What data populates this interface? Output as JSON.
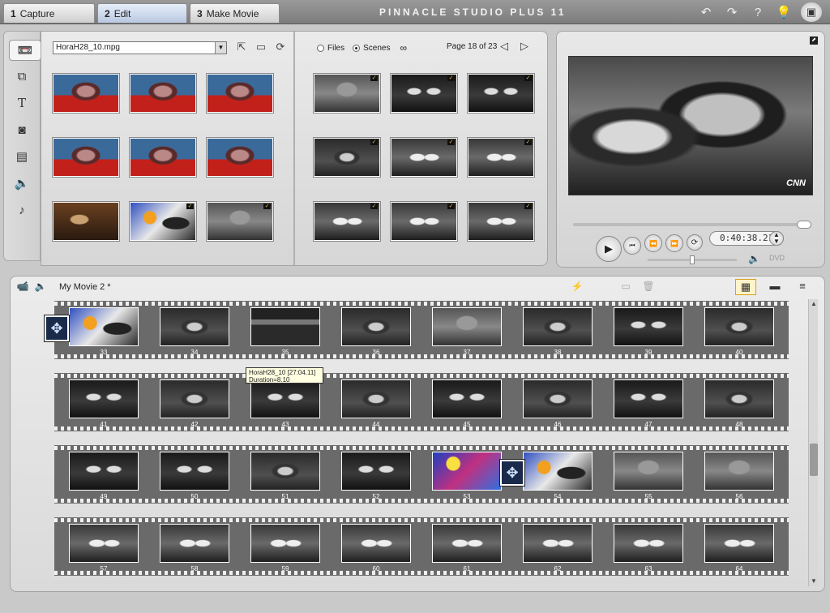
{
  "tabs": [
    {
      "num": "1",
      "label": "Capture"
    },
    {
      "num": "2",
      "label": "Edit"
    },
    {
      "num": "3",
      "label": "Make Movie"
    }
  ],
  "app_title": "PINNACLE STUDIO PLUS 11",
  "top_icons": {
    "undo": "↶",
    "redo": "↷",
    "help": "?",
    "hint": "💡",
    "box": "▣"
  },
  "album": {
    "file_name": "HoraH28_10.mpg",
    "radio_files": "Files",
    "radio_scenes": "Scenes",
    "page_label": "Page 18 of 23"
  },
  "player": {
    "timecode": "0:40:38.21",
    "channel_logo": "CNN",
    "dvd_label": "DVD"
  },
  "storyboard": {
    "title": "My Movie 2 *",
    "rows": [
      [
        "33",
        "34",
        "35",
        "36",
        "37",
        "38",
        "39",
        "40"
      ],
      [
        "41",
        "42",
        "43",
        "44",
        "45",
        "46",
        "47",
        "48"
      ],
      [
        "49",
        "50",
        "51",
        "52",
        "53",
        "54",
        "55",
        "56"
      ],
      [
        "57",
        "58",
        "59",
        "60",
        "61",
        "62",
        "63",
        "64"
      ]
    ],
    "tooltip_line1": "HoraH28_10 [27:04.11]",
    "tooltip_line2": "Duration=8.10"
  }
}
